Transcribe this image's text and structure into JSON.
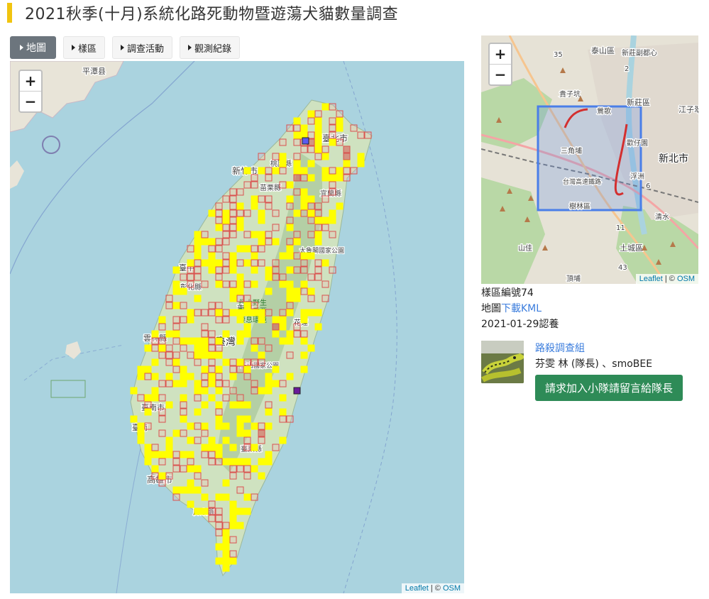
{
  "page": {
    "title": "2021秋季(十月)系統化路死動物暨遊蕩犬貓數量調查"
  },
  "tabs": [
    {
      "label": "地圖",
      "active": true
    },
    {
      "label": "樣區"
    },
    {
      "label": "調查活動"
    },
    {
      "label": "觀測紀錄"
    }
  ],
  "map": {
    "zoom_in": "+",
    "zoom_out": "−",
    "attribution_leaflet": "Leaflet",
    "attribution_sep": " | © ",
    "attribution_osm": "OSM",
    "labels": {
      "pingtan": "平潭县",
      "taipei": "臺北市",
      "hsinchu": "新竹市",
      "taoyuan": "桃園縣",
      "miaoli": "苗栗縣",
      "yilan": "宜蘭縣",
      "taroko": "太魯閣國家公園",
      "taichung": "臺中",
      "changhua": "彰化縣",
      "nantou": "南投",
      "danda": "丹大野生動物重要棲息環境",
      "hualien": "花蓮",
      "yunlin": "雲林縣",
      "taiwan": "臺灣",
      "yushan": "玉山國家公園",
      "tainan": "臺南市",
      "tainan2": "臺南",
      "kaohsiung": "高雄市",
      "taitung": "臺東縣",
      "pingtung": "屏東縣"
    },
    "colors": {
      "sea": "#aad3df",
      "land": "#cfe2c0",
      "mountain": "#a8c89a",
      "yellow": "#ffff00",
      "grid": "#d9534f",
      "grid_fill": "#f6b3b3"
    }
  },
  "mini_map": {
    "zoom_in": "+",
    "zoom_out": "−",
    "attribution_leaflet": "Leaflet",
    "attribution_sep": " | © ",
    "attribution_osm": "OSM",
    "labels": {
      "taishan": "泰山區",
      "xinzhuang_sub": "新莊副都心",
      "guizi": "貴子坑",
      "yingge": "鶯歌",
      "xinzhuang": "新莊區",
      "jiangzi": "江子翠",
      "sanjiao": "三角埔",
      "xinbei": "新北市",
      "yingge2": "鶯歌",
      "huanzhuang": "歡仔園",
      "fuzhou": "浮洲",
      "taiwan_hsr": "台灣高速鐵路",
      "shulin": "樹林區",
      "qingshui": "清水",
      "shanjia": "山佳",
      "tucheng": "土城區",
      "dingpu": "頂埔",
      "num35": "35",
      "num2": "2",
      "num6": "6",
      "num11": "11",
      "num43": "43"
    }
  },
  "plot": {
    "id_label": "樣區編號74",
    "map_prefix": "地圖",
    "kml_link": "下載KML",
    "date_text": "2021-01-29認養"
  },
  "team": {
    "name": "路殺調查組",
    "members": "芬雯 林 (隊長) 、smoBEE",
    "join_button": "請求加入小隊請留言給隊長"
  }
}
